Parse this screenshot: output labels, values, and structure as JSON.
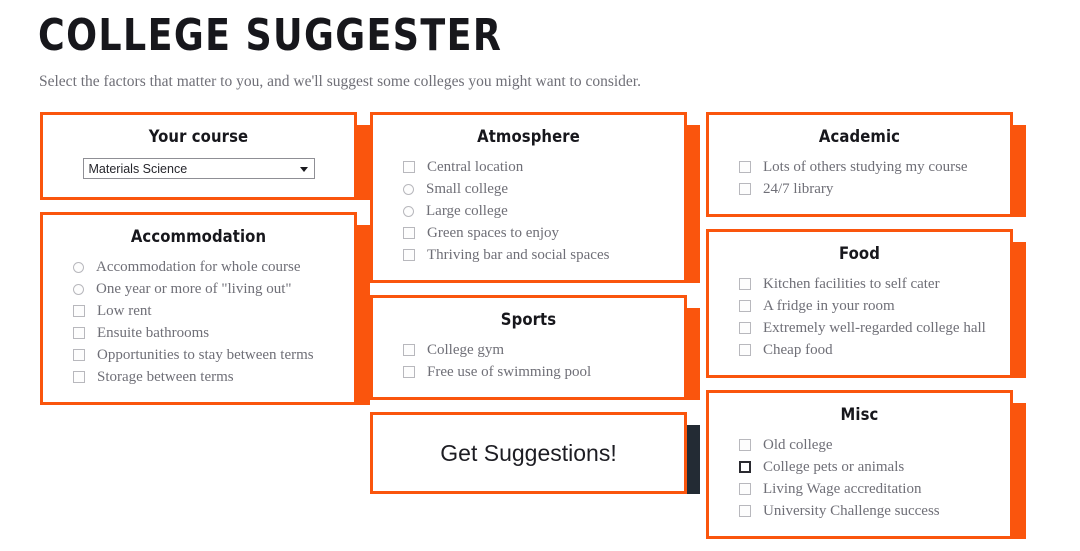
{
  "header": {
    "title": "COLLEGE SUGGESTER",
    "subtitle": "Select the factors that matter to you, and we'll suggest some colleges you might want to consider."
  },
  "theme": {
    "accent": "#fa550d",
    "shadow_dark": "#232b34",
    "text_muted": "#6f6f77",
    "text_dark": "#17171c"
  },
  "columns": [
    {
      "name": "column-left",
      "cards": [
        {
          "id": "your-course",
          "title": "Your course",
          "type": "select",
          "select": {
            "name": "course-select",
            "value": "Materials Science",
            "options": [
              "Materials Science"
            ]
          }
        },
        {
          "id": "accommodation",
          "title": "Accommodation",
          "type": "options",
          "options": [
            {
              "label": "Accommodation for whole course",
              "control": "radio",
              "checked": false,
              "focused": false
            },
            {
              "label": "One year or more of \"living out\"",
              "control": "radio",
              "checked": false,
              "focused": false
            },
            {
              "label": "Low rent",
              "control": "checkbox",
              "checked": false,
              "focused": false
            },
            {
              "label": "Ensuite bathrooms",
              "control": "checkbox",
              "checked": false,
              "focused": false
            },
            {
              "label": "Opportunities to stay between terms",
              "control": "checkbox",
              "checked": false,
              "focused": false
            },
            {
              "label": "Storage between terms",
              "control": "checkbox",
              "checked": false,
              "focused": false
            }
          ]
        }
      ]
    },
    {
      "name": "column-middle",
      "cards": [
        {
          "id": "atmosphere",
          "title": "Atmosphere",
          "type": "options",
          "options": [
            {
              "label": "Central location",
              "control": "checkbox",
              "checked": false,
              "focused": false
            },
            {
              "label": "Small college",
              "control": "radio",
              "checked": false,
              "focused": false
            },
            {
              "label": "Large college",
              "control": "radio",
              "checked": false,
              "focused": false
            },
            {
              "label": "Green spaces to enjoy",
              "control": "checkbox",
              "checked": false,
              "focused": false
            },
            {
              "label": "Thriving bar and social spaces",
              "control": "checkbox",
              "checked": false,
              "focused": false
            }
          ]
        },
        {
          "id": "sports",
          "title": "Sports",
          "type": "options",
          "options": [
            {
              "label": "College gym",
              "control": "checkbox",
              "checked": false,
              "focused": false
            },
            {
              "label": "Free use of swimming pool",
              "control": "checkbox",
              "checked": false,
              "focused": false
            }
          ]
        },
        {
          "id": "submit",
          "title": "",
          "type": "submit",
          "submit_label": "Get Suggestions!"
        }
      ]
    },
    {
      "name": "column-right",
      "cards": [
        {
          "id": "academic",
          "title": "Academic",
          "type": "options",
          "options": [
            {
              "label": "Lots of others studying my course",
              "control": "checkbox",
              "checked": false,
              "focused": false
            },
            {
              "label": "24/7 library",
              "control": "checkbox",
              "checked": false,
              "focused": false
            }
          ]
        },
        {
          "id": "food",
          "title": "Food",
          "type": "options",
          "options": [
            {
              "label": "Kitchen facilities to self cater",
              "control": "checkbox",
              "checked": false,
              "focused": false
            },
            {
              "label": "A fridge in your room",
              "control": "checkbox",
              "checked": false,
              "focused": false
            },
            {
              "label": "Extremely well-regarded college hall",
              "control": "checkbox",
              "checked": false,
              "focused": false
            },
            {
              "label": "Cheap food",
              "control": "checkbox",
              "checked": false,
              "focused": false
            }
          ]
        },
        {
          "id": "misc",
          "title": "Misc",
          "type": "options",
          "options": [
            {
              "label": "Old college",
              "control": "checkbox",
              "checked": false,
              "focused": false
            },
            {
              "label": "College pets or animals",
              "control": "checkbox",
              "checked": false,
              "focused": true
            },
            {
              "label": "Living Wage accreditation",
              "control": "checkbox",
              "checked": false,
              "focused": false
            },
            {
              "label": "University Challenge success",
              "control": "checkbox",
              "checked": false,
              "focused": false
            }
          ]
        }
      ]
    }
  ]
}
